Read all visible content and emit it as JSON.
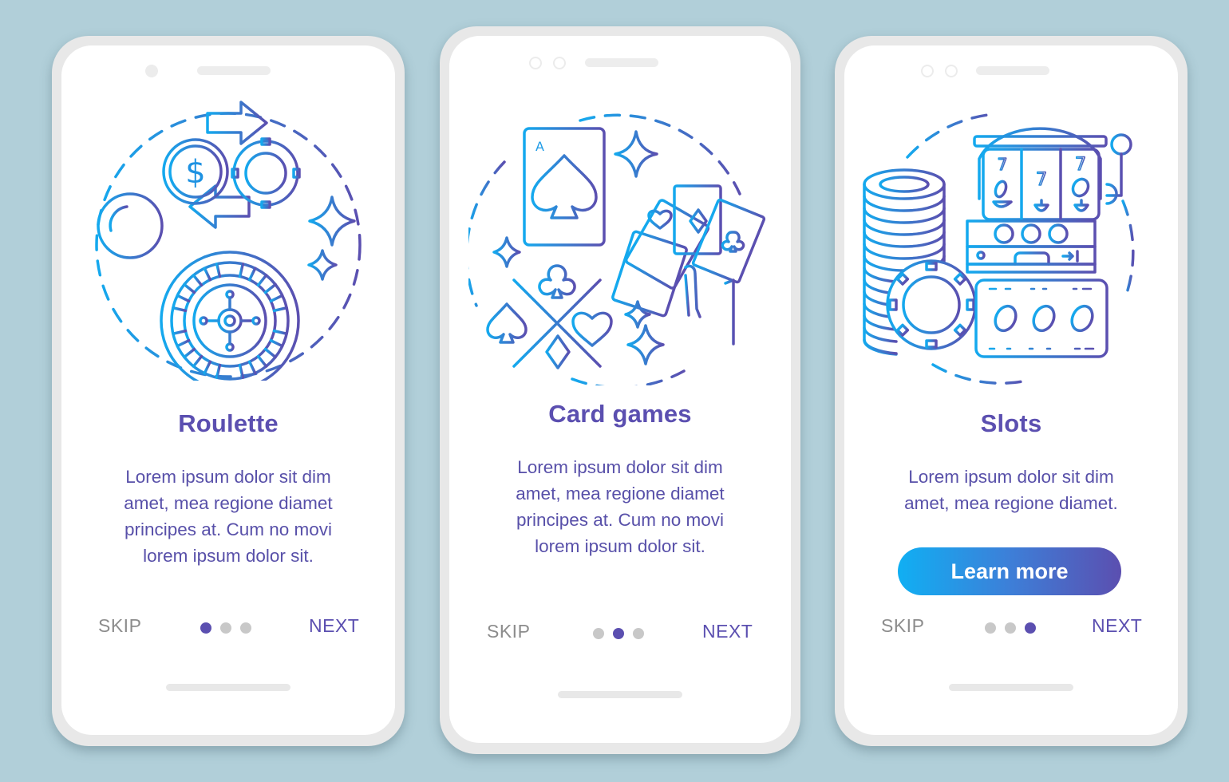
{
  "colors": {
    "background": "#b1cfd9",
    "accent": "#5b4fb0",
    "gradient_start": "#10aff3",
    "gradient_end": "#5b4fb0",
    "skip_text": "#8c8c8c",
    "dot_inactive": "#c8c8c8"
  },
  "screens": [
    {
      "illustration": "roulette-illustration",
      "title": "Roulette",
      "description_lines": [
        "Lorem ipsum dolor sit dim",
        "amet, mea regione diamet",
        "principes at. Cum no movi",
        "lorem ipsum dolor sit."
      ],
      "skip_label": "SKIP",
      "next_label": "NEXT",
      "page_index": 1,
      "page_count": 3
    },
    {
      "illustration": "card-games-illustration",
      "title": "Card games",
      "description_lines": [
        "Lorem ipsum dolor sit dim",
        "amet, mea regione diamet",
        "principes at. Cum no movi",
        "lorem ipsum dolor sit."
      ],
      "skip_label": "SKIP",
      "next_label": "NEXT",
      "page_index": 2,
      "page_count": 3
    },
    {
      "illustration": "slots-illustration",
      "title": "Slots",
      "description_lines": [
        "Lorem ipsum dolor sit dim",
        "amet, mea regione diamet."
      ],
      "button_label": "Learn more",
      "skip_label": "SKIP",
      "next_label": "NEXT",
      "page_index": 3,
      "page_count": 3
    }
  ]
}
